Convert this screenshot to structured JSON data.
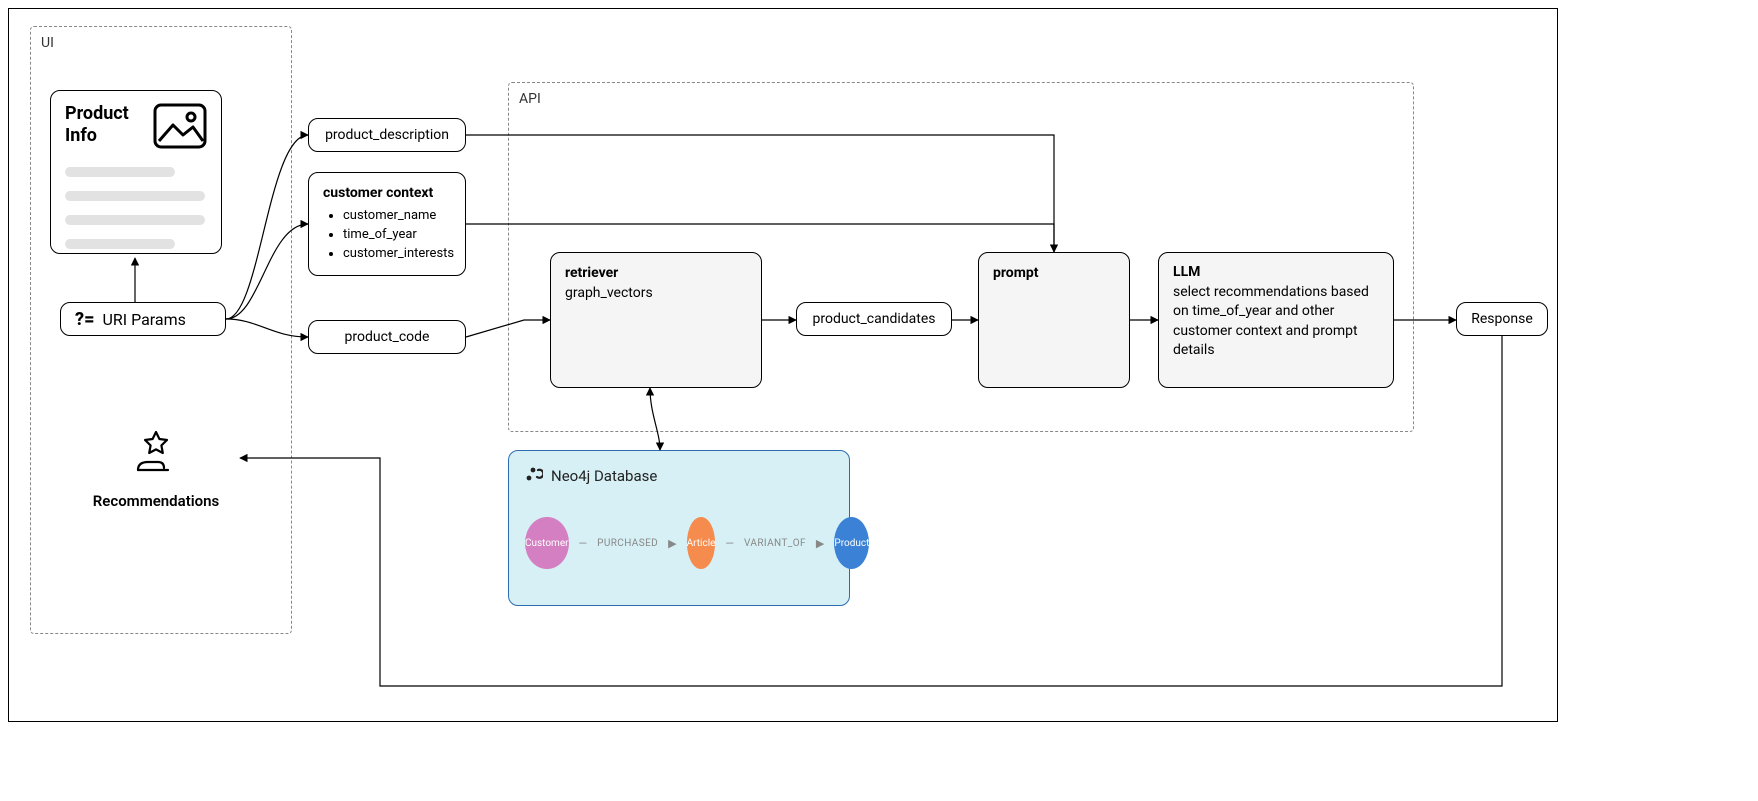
{
  "groups": {
    "ui": "UI",
    "api": "API"
  },
  "product_card": {
    "title": "Product Info"
  },
  "uri_params": {
    "label": "URI Params",
    "glyph": "?="
  },
  "params": {
    "product_description": "product_description",
    "customer_context": {
      "title": "customer context",
      "items": [
        "customer_name",
        "time_of_year",
        "customer_interests"
      ]
    },
    "product_code": "product_code"
  },
  "api_nodes": {
    "retriever": {
      "title": "retriever",
      "subtitle": "graph_vectors"
    },
    "product_candidates": "product_candidates",
    "prompt": {
      "title": "prompt"
    },
    "llm": {
      "title": "LLM",
      "subtitle": "select recommendations based on time_of_year and other customer context and prompt details"
    }
  },
  "neo4j": {
    "title": "Neo4j Database",
    "nodes": [
      "Customer",
      "Article",
      "Product"
    ],
    "rels": [
      "PURCHASED",
      "VARIANT_OF"
    ]
  },
  "response": "Response",
  "recommendations": "Recommendations"
}
